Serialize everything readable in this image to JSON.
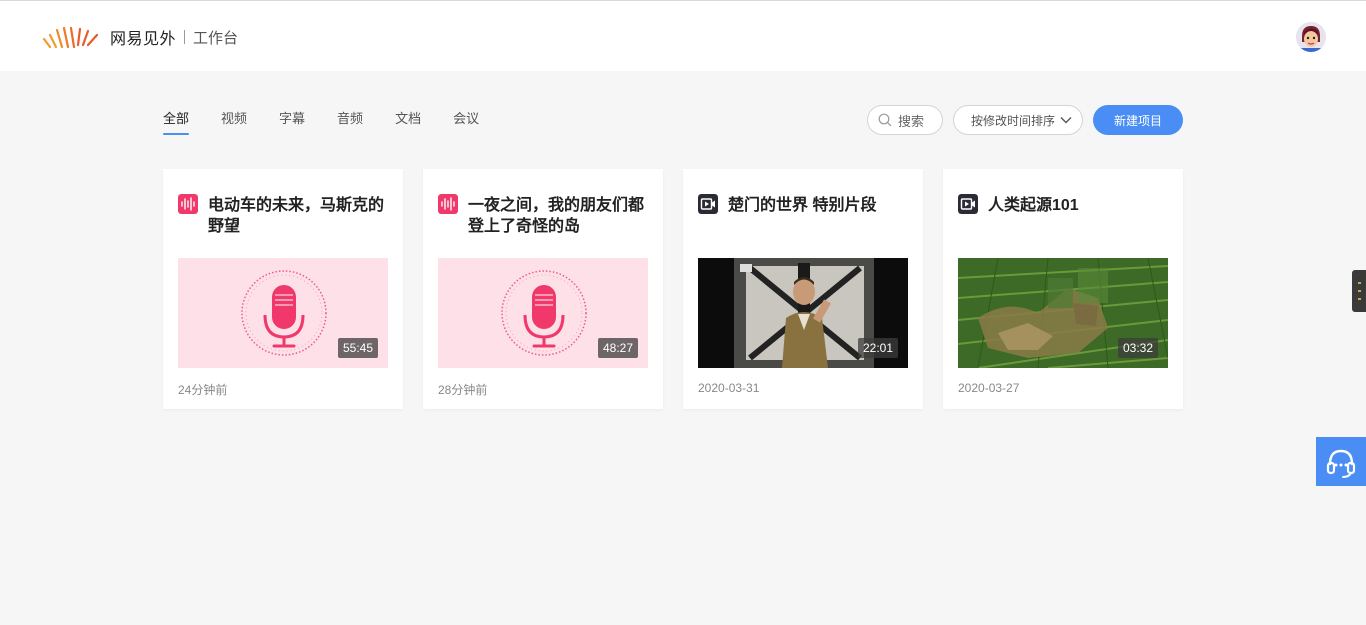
{
  "brand": {
    "name": "网易见外",
    "section": "工作台"
  },
  "tabs": [
    {
      "label": "全部",
      "active": true
    },
    {
      "label": "视频"
    },
    {
      "label": "字幕"
    },
    {
      "label": "音频"
    },
    {
      "label": "文档"
    },
    {
      "label": "会议"
    }
  ],
  "toolbar": {
    "search_label": "搜索",
    "sort_label": "按修改时间排序",
    "new_project_label": "新建项目"
  },
  "projects": [
    {
      "title": "电动车的未来，马斯克的野望",
      "type": "audio",
      "icon": "audio-wave-icon",
      "duration": "55:45",
      "modified": "24分钟前"
    },
    {
      "title": "一夜之间，我的朋友们都登上了奇怪的岛",
      "type": "audio",
      "icon": "audio-wave-icon",
      "duration": "48:27",
      "modified": "28分钟前"
    },
    {
      "title": "楚门的世界 特别片段",
      "type": "video",
      "icon": "video-icon",
      "duration": "22:01",
      "modified": "2020-03-31"
    },
    {
      "title": "人类起源101",
      "type": "video",
      "icon": "video-icon",
      "duration": "03:32",
      "modified": "2020-03-27"
    }
  ],
  "colors": {
    "accent": "#4a8ef5",
    "audio": "#f0386b",
    "audio_bg": "#fde0e8",
    "video_icon": "#2b2b36"
  }
}
